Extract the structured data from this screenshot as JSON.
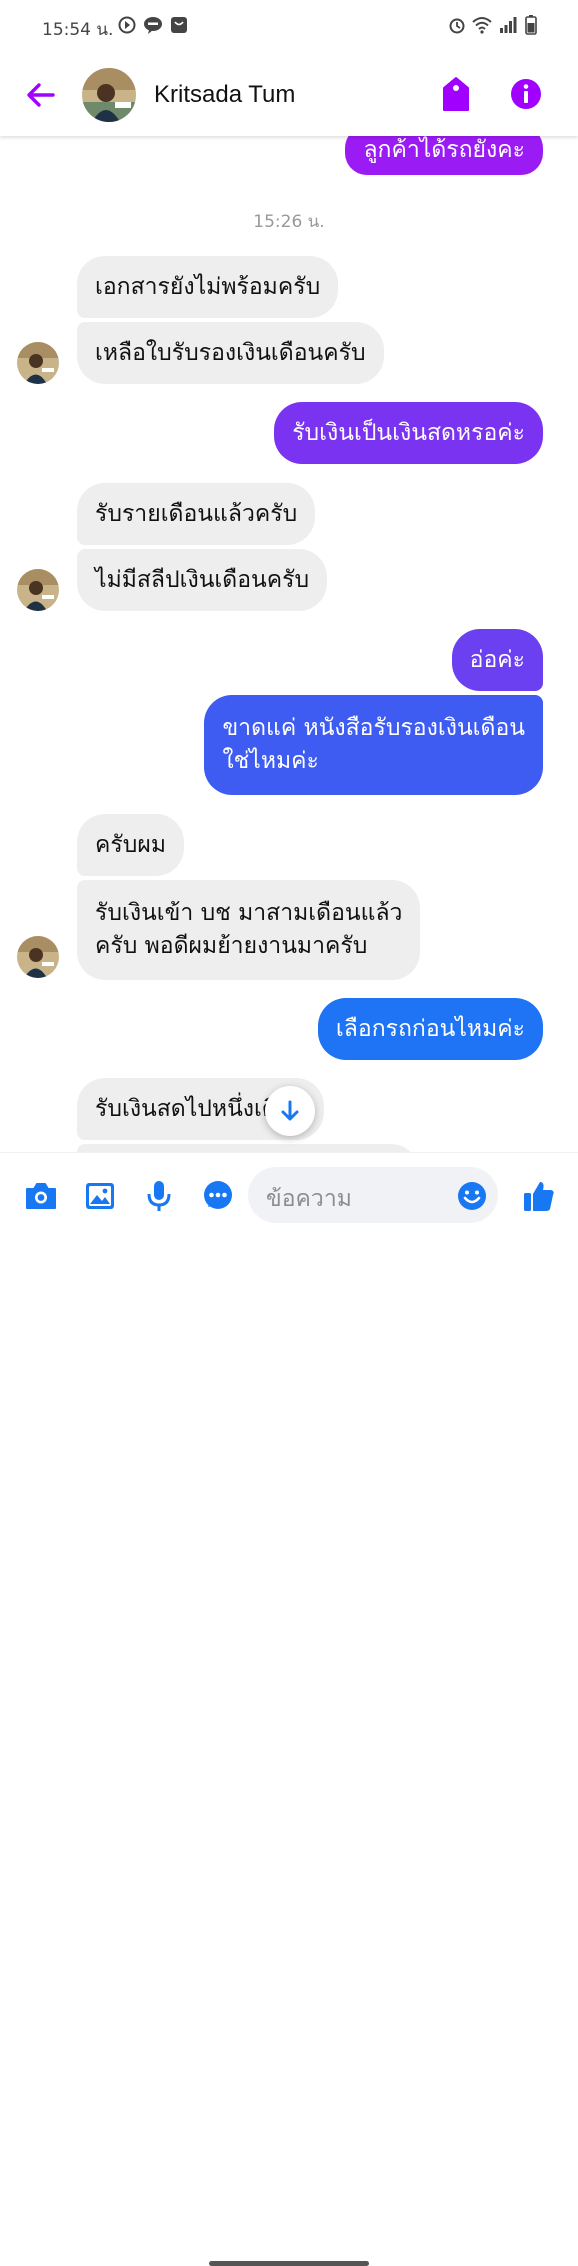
{
  "status_bar": {
    "time": "15:54 น."
  },
  "header": {
    "contact_name": "Kritsada Tum"
  },
  "chat": {
    "timestamp": "15:26 น.",
    "messages": [
      {
        "dir": "out",
        "text": "ลูกค้าได้รถยังคะ"
      },
      {
        "dir": "in",
        "text": "เอกสารยังไม่พร้อมครับ"
      },
      {
        "dir": "in",
        "text": "เหลือใบรับรองเงินเดือนครับ"
      },
      {
        "dir": "out",
        "text": "รับเงินเป็นเงินสดหรอค่ะ"
      },
      {
        "dir": "in",
        "text": "รับรายเดือนแล้วครับ"
      },
      {
        "dir": "in",
        "text": "ไม่มีสลีปเงินเดือนครับ"
      },
      {
        "dir": "out",
        "text": "อ่อค่ะ"
      },
      {
        "dir": "out",
        "text": "ขาดแค่ หนังสือรับรองเงินเดือน\nใช่ไหมค่ะ"
      },
      {
        "dir": "in",
        "text": "ครับผม"
      },
      {
        "dir": "in",
        "text": "รับเงินเข้า บช มาสามเดือนแล้ว\nครับ พอดีผมย้ายงานมาครับ"
      },
      {
        "dir": "out",
        "text": "เลือกรถก่อนไหมค่ะ"
      },
      {
        "dir": "in",
        "text": "รับเงินสดไปหนึ่งเดือน"
      }
    ]
  },
  "composer": {
    "placeholder": "ข้อความ"
  },
  "colors": {
    "accent": "#a100ff",
    "out_purple": "#9b1bf5",
    "out_violet": "#7a33f0",
    "out_blue": "#3e5cf2",
    "out_blue2": "#1e74f5",
    "in_bg": "#eeeeee"
  }
}
